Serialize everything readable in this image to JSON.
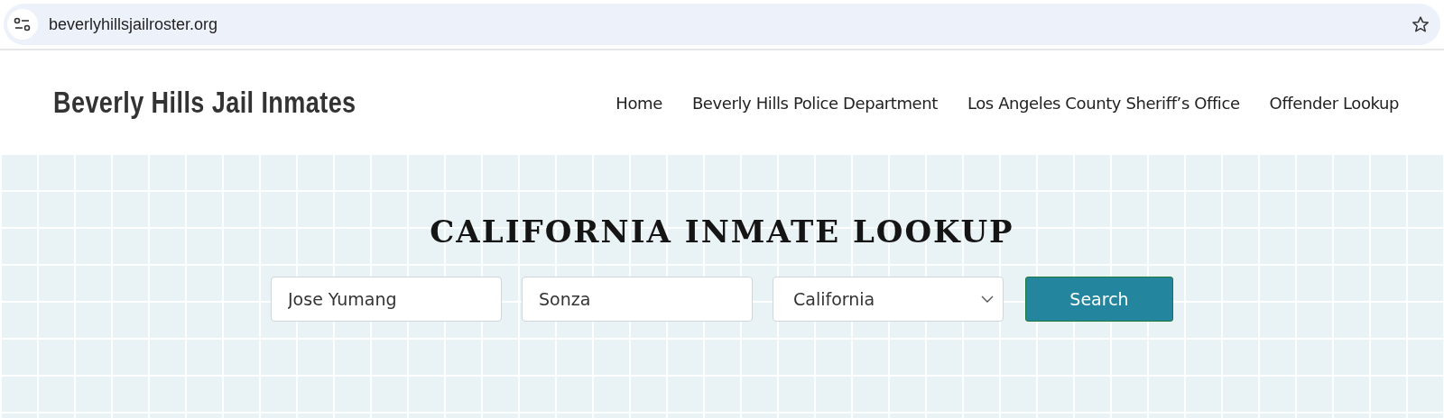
{
  "browser": {
    "url": "beverlyhillsjailroster.org"
  },
  "header": {
    "site_title": "Beverly Hills Jail Inmates",
    "nav": [
      {
        "label": "Home"
      },
      {
        "label": "Beverly Hills Police Department"
      },
      {
        "label": "Los Angeles County Sheriff’s Office"
      },
      {
        "label": "Offender Lookup"
      }
    ]
  },
  "hero": {
    "heading": "CALIFORNIA INMATE LOOKUP",
    "search_form": {
      "first_name": {
        "value": "Jose Yumang"
      },
      "last_name": {
        "value": "Sonza"
      },
      "state": {
        "value": "California"
      },
      "button": "Search"
    }
  }
}
